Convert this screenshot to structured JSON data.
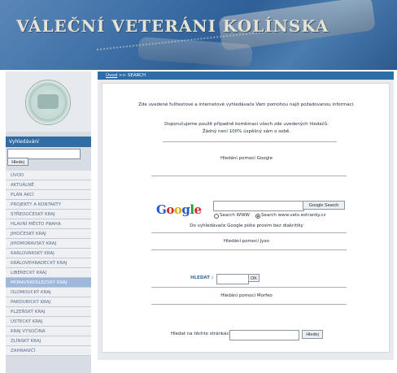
{
  "header": {
    "title": "VÁLEČNÍ VETERÁNI KOLÍNSKA"
  },
  "sidebar": {
    "search_heading": "Vyhledávání",
    "search_button": "Hledej",
    "menu": [
      "ÚVOD",
      "AKTUÁLNĚ",
      "PLÁN AKCÍ",
      "PROJEKTY A KONTAKTY",
      "STŘEDOČESKÝ KRAJ",
      "HLAVNÍ MĚSTO PRAHA",
      "JIHOČESKÝ KRAJ",
      "JIHOMORAVSKÝ KRAJ",
      "KARLOVARSKÝ KRAJ",
      "KRÁLOVEHRADECKÝ KRAJ",
      "LIBERECKÝ KRAJ",
      "MORAVSKOSLEZSKÝ KRAJ",
      "OLOMOUCKÝ KRAJ",
      "PARDUBICKÝ KRAJ",
      "PLZEŇSKÝ KRAJ",
      "ÚSTECKÝ KRAJ",
      "KRAJ VYSOČINA",
      "ZLÍNSKÝ KRAJ",
      "ZAHRANIČÍ"
    ],
    "active_index": 11
  },
  "breadcrumb": {
    "home": "Úvod",
    "separator": " >> ",
    "current": "SEARCH"
  },
  "content": {
    "intro": "Zde uvedené fulltextové a internetové vyhledávače Vám pomohou najít požadovanou informaci.",
    "tip_line1": "Doporučujeme použít případně kombinaci všech zde uvedených hledačů.",
    "tip_line2": "Žádný není 100% úspěšný sám o sobě.",
    "google_heading": "Hledání pomocí Google",
    "google_logo": "Google",
    "google_button": "Google Search",
    "radio_www": "Search WWW",
    "radio_site": "Search www.vets.estranky.cz",
    "google_note": "Do vyhledávače Google pište prosím bez diakritiky",
    "jyxo_heading": "Hledání pomocí Jyxo",
    "jyxo_label": "HLEDAT :",
    "jyxo_button": "OK",
    "morfeo_heading": "Hledání pomocí Morfeo",
    "site_label": "Hledat na těchto stránkách",
    "site_button": "Hledej"
  }
}
